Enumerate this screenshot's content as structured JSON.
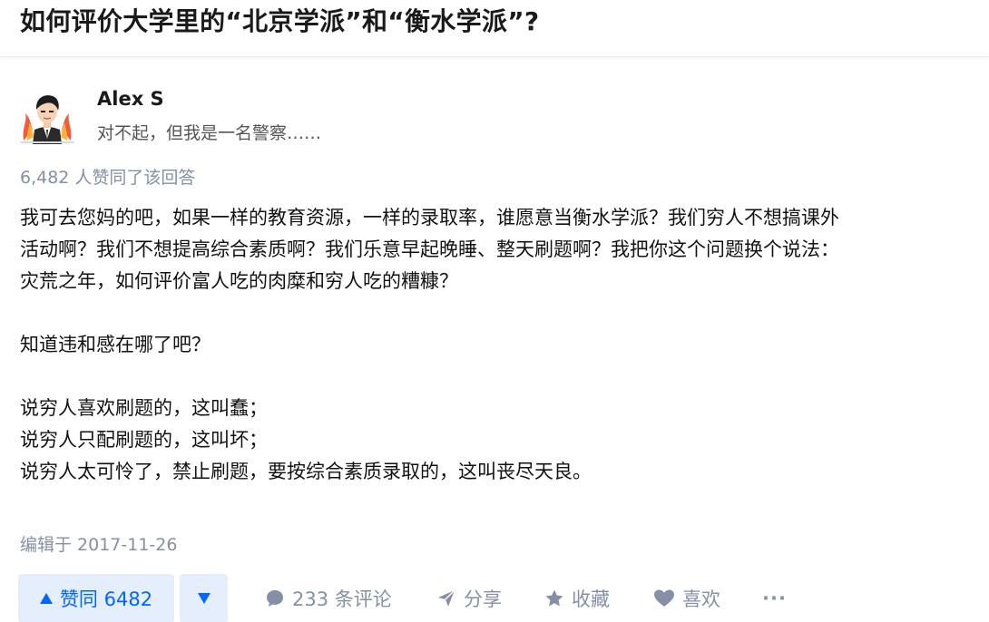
{
  "question": {
    "title": "如何评价大学里的“北京学派”和“衡水学派”?"
  },
  "author": {
    "name": "Alex S",
    "headline": "对不起，但我是一名警察……",
    "avatar_icon": "avatar-cartoon-man"
  },
  "answer": {
    "vote_summary": "6,482 人赞同了该回答",
    "paragraphs": [
      "我可去您妈的吧，如果一样的教育资源，一样的录取率，谁愿意当衡水学派？我们穷人不想搞课外",
      "活动啊？我们不想提高综合素质啊？我们乐意早起晚睡、整天刷题啊？我把你这个问题换个说法：",
      "灾荒之年，如何评价富人吃的肉糜和穷人吃的糟糠？",
      "",
      "知道违和感在哪了吧？",
      "",
      "说穷人喜欢刷题的，这叫蠢；",
      "说穷人只配刷题的，这叫坏；",
      "说穷人太可怜了，禁止刷题，要按综合素质录取的，这叫丧尽天良。"
    ],
    "edit_time": "编辑于 2017-11-26"
  },
  "actions": {
    "upvote_label": "赞同 6482",
    "comments_label": "233 条评论",
    "share_label": "分享",
    "collect_label": "收藏",
    "like_label": "喜欢",
    "more_label": "···"
  },
  "colors": {
    "accent": "#0066ff",
    "accent_bg": "#e5eefc",
    "meta_text": "#8590a6",
    "body_text": "#121212"
  }
}
